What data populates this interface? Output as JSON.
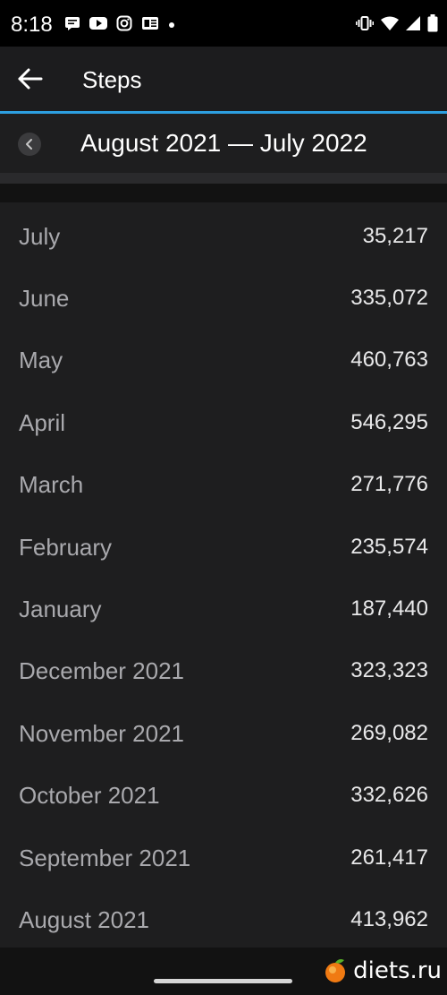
{
  "status_bar": {
    "time": "8:18",
    "left_icons": [
      "message-icon",
      "youtube-icon",
      "instagram-icon",
      "news-icon",
      "dot-icon"
    ],
    "right_icons": [
      "vibrate-icon",
      "wifi-icon",
      "signal-icon",
      "battery-icon"
    ]
  },
  "app_bar": {
    "title": "Steps",
    "accent_color": "#2d9fe0"
  },
  "range": {
    "label": "August 2021 — July 2022"
  },
  "months": [
    {
      "label": "July",
      "value": "35,217"
    },
    {
      "label": "June",
      "value": "335,072"
    },
    {
      "label": "May",
      "value": "460,763"
    },
    {
      "label": "April",
      "value": "546,295"
    },
    {
      "label": "March",
      "value": "271,776"
    },
    {
      "label": "February",
      "value": "235,574"
    },
    {
      "label": "January",
      "value": "187,440"
    },
    {
      "label": "December 2021",
      "value": "323,323"
    },
    {
      "label": "November 2021",
      "value": "269,082"
    },
    {
      "label": "October 2021",
      "value": "332,626"
    },
    {
      "label": "September 2021",
      "value": "261,417"
    },
    {
      "label": "August 2021",
      "value": "413,962"
    }
  ],
  "watermark": {
    "text": "diets.ru"
  }
}
